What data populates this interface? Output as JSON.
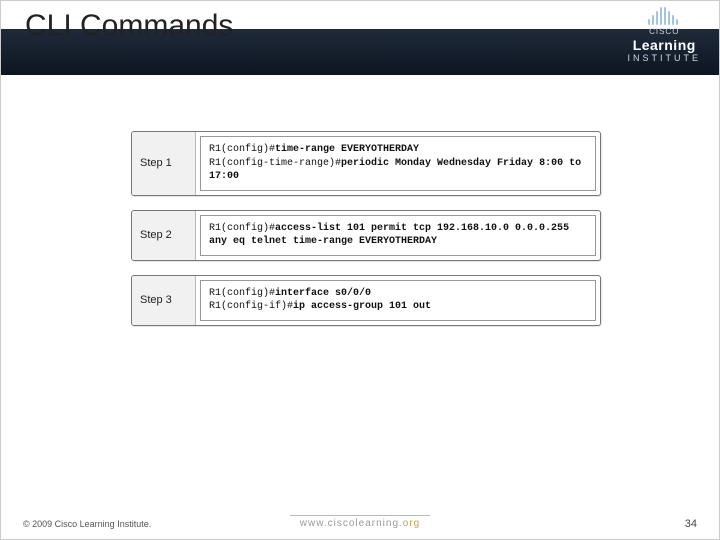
{
  "header": {
    "title": "CLI Commands",
    "brand_small": "CISCO",
    "brand_main": "Learning",
    "brand_sub": "INSTITUTE"
  },
  "steps": [
    {
      "label": "Step 1",
      "lines": [
        {
          "prompt": "R1(config)#",
          "cmd": "time-range EVERYOTHERDAY"
        },
        {
          "prompt": "R1(config-time-range)#",
          "cmd": "periodic Monday Wednesday Friday 8:00 to 17:00"
        }
      ]
    },
    {
      "label": "Step 2",
      "lines": [
        {
          "prompt": "R1(config)#",
          "cmd": "access-list 101 permit tcp 192.168.10.0 0.0.0.255 any eq telnet time-range EVERYOTHERDAY"
        }
      ]
    },
    {
      "label": "Step 3",
      "lines": [
        {
          "prompt": "R1(config)#",
          "cmd": "interface s0/0/0"
        },
        {
          "prompt": "R1(config-if)#",
          "cmd": "ip access-group 101 out"
        }
      ]
    }
  ],
  "footer": {
    "copyright": "© 2009 Cisco Learning Institute.",
    "url_main": "www.ciscolearning",
    "url_tld": ".org",
    "page": "34"
  }
}
